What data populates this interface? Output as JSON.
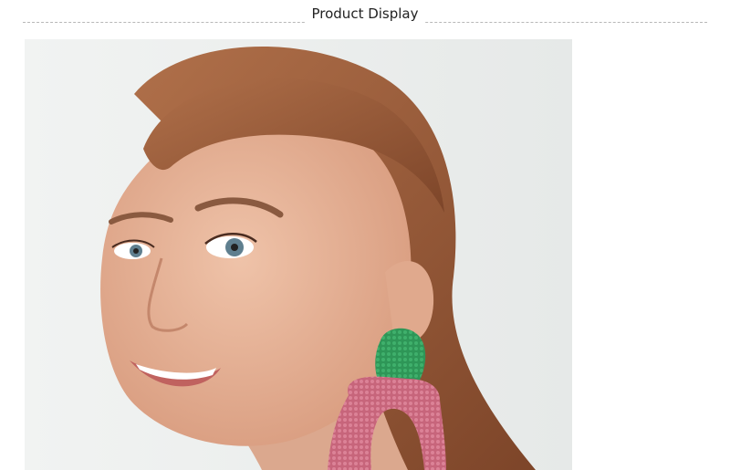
{
  "header": {
    "title": "Product Display"
  },
  "photo": {
    "subject": "model-wearing-earring",
    "colors": {
      "background": "#eef0ef",
      "skin": "#e8b49a",
      "hair": "#9a5c3a",
      "earring_top": "#2f9a5a",
      "earring_bottom": "#cf6f84"
    }
  }
}
